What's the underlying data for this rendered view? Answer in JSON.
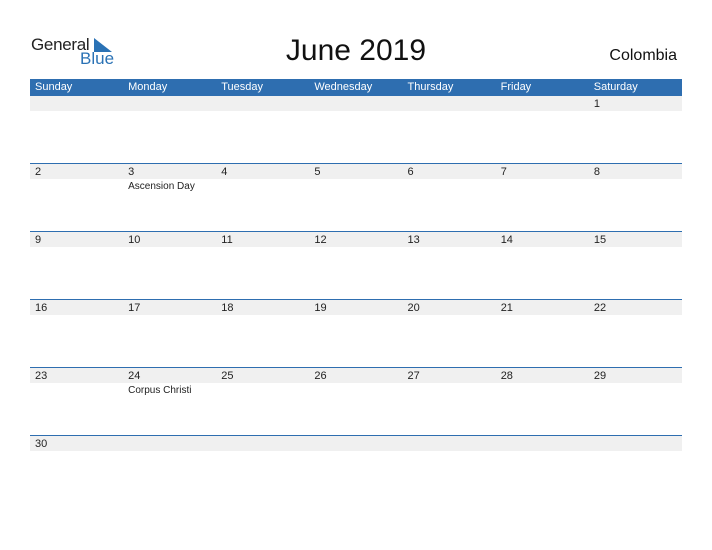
{
  "logo": {
    "general": "General",
    "blue": "Blue"
  },
  "title": "June 2019",
  "country": "Colombia",
  "colors": {
    "accent": "#2e6eb0",
    "shade": "#f0f0f0"
  },
  "weekdays": [
    "Sunday",
    "Monday",
    "Tuesday",
    "Wednesday",
    "Thursday",
    "Friday",
    "Saturday"
  ],
  "weeks": [
    [
      {
        "day": ""
      },
      {
        "day": ""
      },
      {
        "day": ""
      },
      {
        "day": ""
      },
      {
        "day": ""
      },
      {
        "day": ""
      },
      {
        "day": "1"
      }
    ],
    [
      {
        "day": "2"
      },
      {
        "day": "3",
        "holiday": "Ascension Day"
      },
      {
        "day": "4"
      },
      {
        "day": "5"
      },
      {
        "day": "6"
      },
      {
        "day": "7"
      },
      {
        "day": "8"
      }
    ],
    [
      {
        "day": "9"
      },
      {
        "day": "10"
      },
      {
        "day": "11"
      },
      {
        "day": "12"
      },
      {
        "day": "13"
      },
      {
        "day": "14"
      },
      {
        "day": "15"
      }
    ],
    [
      {
        "day": "16"
      },
      {
        "day": "17"
      },
      {
        "day": "18"
      },
      {
        "day": "19"
      },
      {
        "day": "20"
      },
      {
        "day": "21"
      },
      {
        "day": "22"
      }
    ],
    [
      {
        "day": "23"
      },
      {
        "day": "24",
        "holiday": "Corpus Christi"
      },
      {
        "day": "25"
      },
      {
        "day": "26"
      },
      {
        "day": "27"
      },
      {
        "day": "28"
      },
      {
        "day": "29"
      }
    ],
    [
      {
        "day": "30"
      },
      {
        "day": ""
      },
      {
        "day": ""
      },
      {
        "day": ""
      },
      {
        "day": ""
      },
      {
        "day": ""
      },
      {
        "day": ""
      }
    ]
  ]
}
